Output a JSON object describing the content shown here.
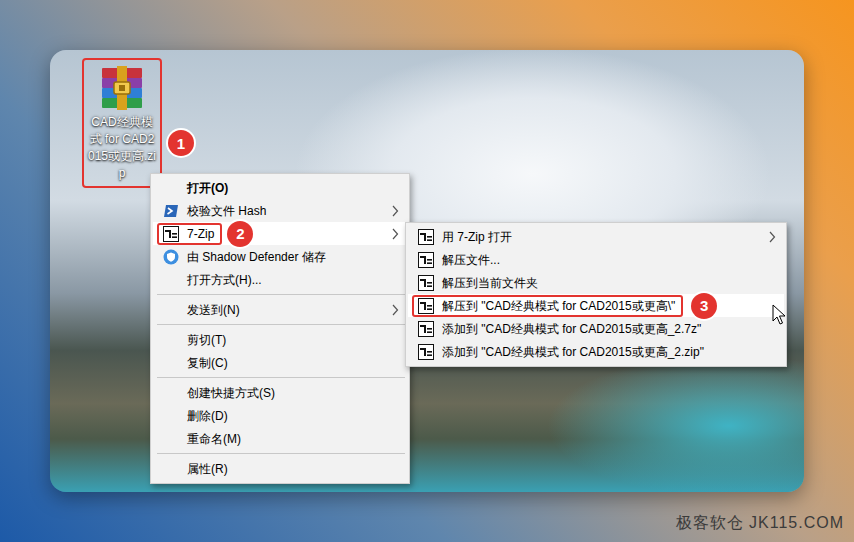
{
  "desktop": {
    "icon": {
      "label": "CAD经典模式 for CAD2015或更高.zip",
      "annotated": true,
      "badge": "1"
    }
  },
  "context_menu": {
    "items": [
      {
        "kind": "plain",
        "label": "打开(O)",
        "default": true,
        "selected": false,
        "submenu": false,
        "annotated": false
      },
      {
        "kind": "hash",
        "label": "校验文件 Hash",
        "default": false,
        "selected": false,
        "submenu": true,
        "annotated": false
      },
      {
        "kind": "archive",
        "label": "7-Zip",
        "default": false,
        "selected": true,
        "submenu": true,
        "annotated": true,
        "badge": "2"
      },
      {
        "kind": "shield",
        "label": "由 Shadow Defender 储存",
        "default": false,
        "selected": false,
        "submenu": false,
        "annotated": false
      },
      {
        "kind": "plain",
        "label": "打开方式(H)...",
        "default": false,
        "selected": false,
        "submenu": false,
        "annotated": false
      },
      {
        "kind": "separator"
      },
      {
        "kind": "plain",
        "label": "发送到(N)",
        "default": false,
        "selected": false,
        "submenu": true,
        "annotated": false
      },
      {
        "kind": "separator"
      },
      {
        "kind": "plain",
        "label": "剪切(T)",
        "default": false,
        "selected": false,
        "submenu": false,
        "annotated": false
      },
      {
        "kind": "plain",
        "label": "复制(C)",
        "default": false,
        "selected": false,
        "submenu": false,
        "annotated": false
      },
      {
        "kind": "separator"
      },
      {
        "kind": "plain",
        "label": "创建快捷方式(S)",
        "default": false,
        "selected": false,
        "submenu": false,
        "annotated": false
      },
      {
        "kind": "plain",
        "label": "删除(D)",
        "default": false,
        "selected": false,
        "submenu": false,
        "annotated": false
      },
      {
        "kind": "plain",
        "label": "重命名(M)",
        "default": false,
        "selected": false,
        "submenu": false,
        "annotated": false
      },
      {
        "kind": "separator"
      },
      {
        "kind": "plain",
        "label": "属性(R)",
        "default": false,
        "selected": false,
        "submenu": false,
        "annotated": false
      }
    ]
  },
  "submenu": {
    "items": [
      {
        "kind": "archive",
        "label": "用 7-Zip 打开",
        "default": false,
        "selected": false,
        "submenu": true,
        "annotated": false
      },
      {
        "kind": "archive",
        "label": "解压文件...",
        "default": false,
        "selected": false,
        "submenu": false,
        "annotated": false
      },
      {
        "kind": "archive",
        "label": "解压到当前文件夹",
        "default": false,
        "selected": false,
        "submenu": false,
        "annotated": false
      },
      {
        "kind": "archive",
        "label": "解压到 \"CAD经典模式 for CAD2015或更高\\\"",
        "default": false,
        "selected": true,
        "submenu": false,
        "annotated": true,
        "badge": "3"
      },
      {
        "kind": "archive",
        "label": "添加到 \"CAD经典模式 for CAD2015或更高_2.7z\"",
        "default": false,
        "selected": false,
        "submenu": false,
        "annotated": false
      },
      {
        "kind": "archive",
        "label": "添加到 \"CAD经典模式 for CAD2015或更高_2.zip\"",
        "default": false,
        "selected": false,
        "submenu": false,
        "annotated": false
      }
    ]
  },
  "watermark": "极客软仓 JK115.COM"
}
